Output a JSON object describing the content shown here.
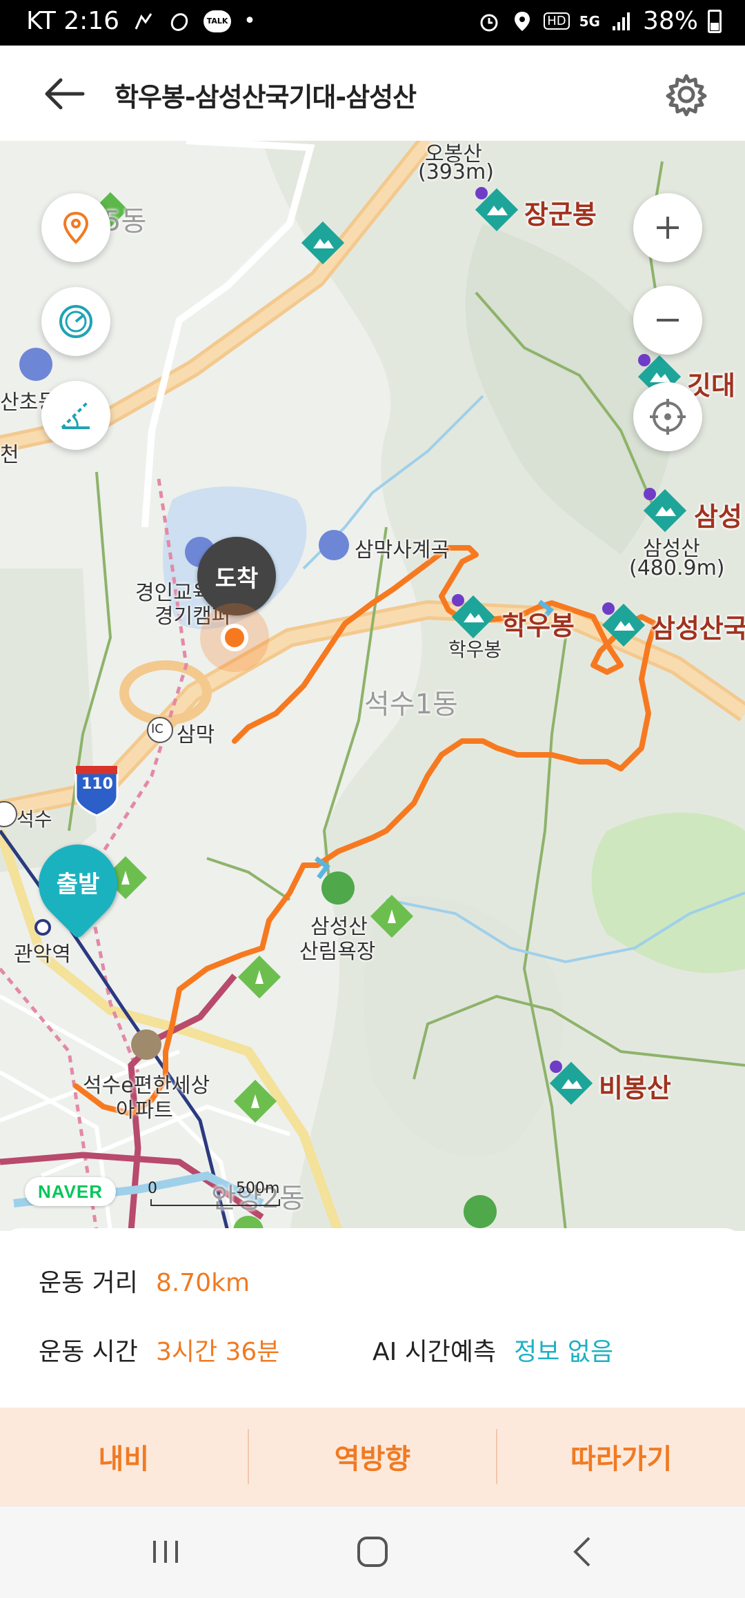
{
  "status_bar": {
    "carrier_time": "KT 2:16",
    "dot": "•",
    "battery": "38%",
    "icons": [
      "fitness-app-icon",
      "sneaker-icon",
      "talk-icon",
      "alarm-icon",
      "location-icon",
      "hd-icon",
      "5g-icon",
      "signal-icon",
      "battery-icon"
    ],
    "hd": "HD",
    "net": "5G",
    "talk": "TALK"
  },
  "header": {
    "title": "학우봉-삼성산국기대-삼성산"
  },
  "map": {
    "markers": {
      "start": "출발",
      "end": "도착"
    },
    "peaks": [
      "장군봉",
      "학우봉",
      "삼성산국",
      "삼성",
      "비봉산",
      "깃대"
    ],
    "labels": {
      "summit_top": "오봉산",
      "summit_top_height": "(393m)",
      "dong5": "5동",
      "chodong": "산초동",
      "cheon": "천",
      "sammak_valley": "삼막사계곡",
      "school": "경인교육",
      "school2": "경기캠퍼",
      "haku_sub": "학우봉",
      "samsungsan_sub": "삼성산",
      "samsungsan_height": "(480.9m)",
      "seoksu1": "석수1동",
      "ic_sammak": "삼막",
      "ic": "IC",
      "highway": "110",
      "seoksu": "석수",
      "gwanak": "관악역",
      "forest": "삼성산",
      "forest2": "산림욕장",
      "apt": "석수e편한세상",
      "apt2": "아파트",
      "anyang2": "안양2동"
    },
    "naver": "NAVER",
    "scale_zero": "0",
    "scale_dist": "500m",
    "accent": "#f07a22",
    "route_color": "#f7791f",
    "start_color": "#1bb2c0"
  },
  "stats": {
    "distance_label": "운동 거리",
    "distance_value": "8.70km",
    "time_label": "운동 시간",
    "time_value": "3시간 36분",
    "ai_label": "AI 시간예측",
    "ai_value": "정보 없음"
  },
  "actions": {
    "navigate": "내비",
    "reverse": "역방향",
    "follow": "따라가기"
  }
}
